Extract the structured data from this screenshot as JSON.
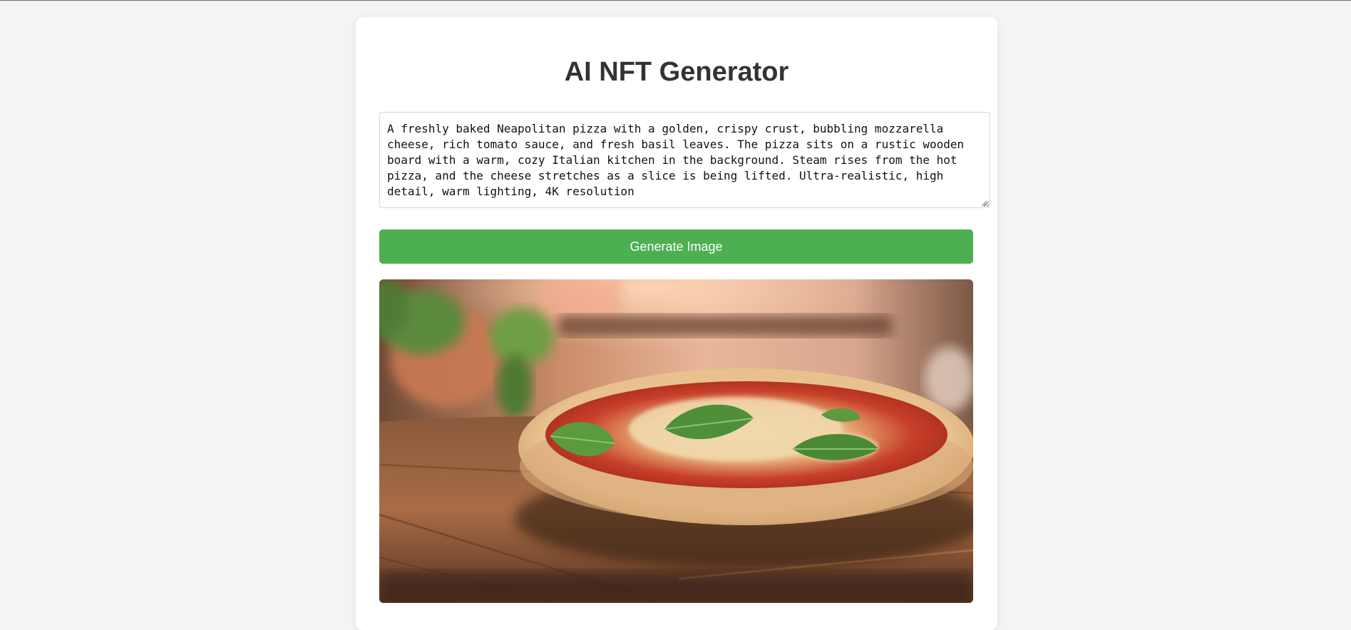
{
  "app": {
    "title": "AI NFT Generator"
  },
  "prompt": {
    "value": "A freshly baked Neapolitan pizza with a golden, crispy crust, bubbling mozzarella cheese, rich tomato sauce, and fresh basil leaves. The pizza sits on a rustic wooden board with a warm, cozy Italian kitchen in the background. Steam rises from the hot pizza, and the cheese stretches as a slice is being lifted. Ultra-realistic, high detail, warm lighting, 4K resolution"
  },
  "actions": {
    "generate_label": "Generate Image"
  },
  "result": {
    "depicts": "pizza-on-wooden-table"
  },
  "colors": {
    "background": "#f4f4f4",
    "card": "#ffffff",
    "button": "#4caf50",
    "title": "#333333"
  }
}
